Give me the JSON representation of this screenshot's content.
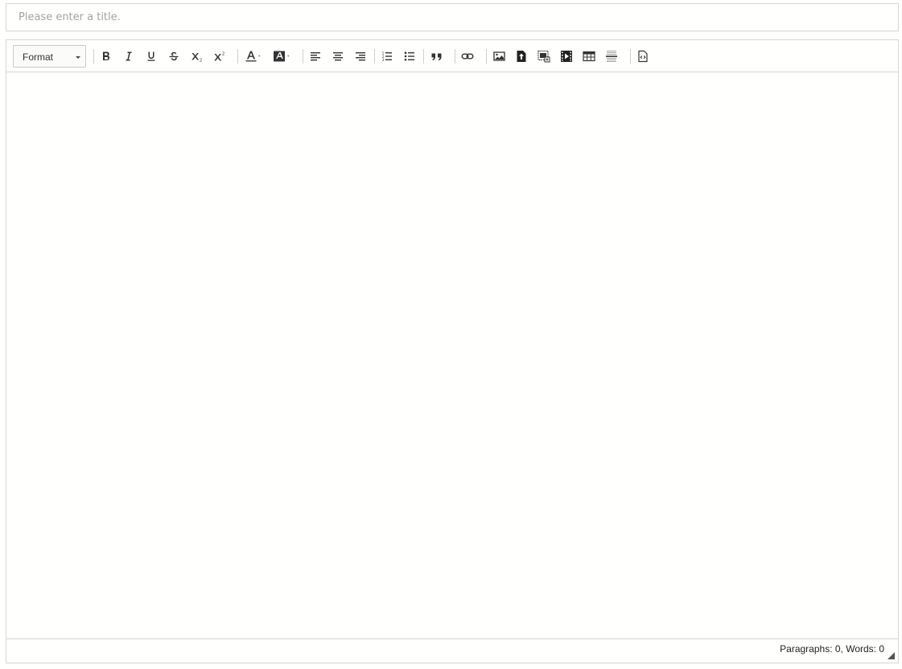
{
  "title": {
    "placeholder": "Please enter a title.",
    "value": ""
  },
  "toolbar": {
    "format_label": "Format",
    "buttons": [
      {
        "name": "bold",
        "icon": "bold-icon"
      },
      {
        "name": "italic",
        "icon": "italic-icon"
      },
      {
        "name": "underline",
        "icon": "underline-icon"
      },
      {
        "name": "strikethrough",
        "icon": "strikethrough-icon"
      },
      {
        "name": "subscript",
        "icon": "subscript-icon"
      },
      {
        "name": "superscript",
        "icon": "superscript-icon"
      },
      {
        "name": "font-color",
        "icon": "font-color-icon"
      },
      {
        "name": "background-color",
        "icon": "background-color-icon"
      },
      {
        "name": "align-left",
        "icon": "align-left-icon"
      },
      {
        "name": "align-center",
        "icon": "align-center-icon"
      },
      {
        "name": "align-right",
        "icon": "align-right-icon"
      },
      {
        "name": "ordered-list",
        "icon": "ordered-list-icon"
      },
      {
        "name": "unordered-list",
        "icon": "unordered-list-icon"
      },
      {
        "name": "blockquote",
        "icon": "quote-icon"
      },
      {
        "name": "link",
        "icon": "link-icon"
      },
      {
        "name": "image",
        "icon": "image-icon"
      },
      {
        "name": "file",
        "icon": "file-upload-icon"
      },
      {
        "name": "image-gallery",
        "icon": "image-gallery-icon"
      },
      {
        "name": "video",
        "icon": "video-icon"
      },
      {
        "name": "table",
        "icon": "table-icon"
      },
      {
        "name": "horizontal-rule",
        "icon": "horizontal-rule-icon"
      },
      {
        "name": "code-view",
        "icon": "code-view-icon"
      }
    ]
  },
  "content": {
    "text": ""
  },
  "status": {
    "text": "Paragraphs: 0, Words: 0"
  }
}
